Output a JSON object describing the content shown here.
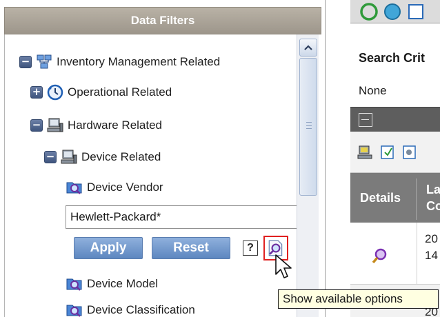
{
  "filters_panel": {
    "title": "Data Filters",
    "tree": {
      "inventory": {
        "label": "Inventory Management Related",
        "toggle": "−"
      },
      "operational": {
        "label": "Operational Related",
        "toggle": "+"
      },
      "hardware": {
        "label": "Hardware Related",
        "toggle": "−"
      },
      "device": {
        "label": "Device Related",
        "toggle": "−"
      },
      "vendor": {
        "label": "Device Vendor"
      },
      "model": {
        "label": "Device Model"
      },
      "classification": {
        "label": "Device Classification"
      }
    },
    "vendor_filter": {
      "value": "Hewlett-Packard*",
      "apply_label": "Apply",
      "reset_label": "Reset",
      "help_label": "?"
    },
    "tooltip": "Show available options"
  },
  "results_panel": {
    "search_criteria_title": "Search Crit",
    "search_criteria_value": "None",
    "columns": {
      "details": "Details",
      "last": "La\nCo"
    },
    "rows": [
      {
        "date": "20\n14"
      },
      {
        "date": "20"
      }
    ]
  },
  "colors": {
    "panel_header": "#a59e93",
    "button": "#6b93c8",
    "toggle": "#4a5f88",
    "grid_header": "#5e5e5e",
    "tooltip_bg": "#ffffe1",
    "highlight": "#e02020"
  },
  "icons": [
    "network-hierarchy-icon",
    "clock-icon",
    "computer-icon",
    "folder-search-icon",
    "magnifier-icon",
    "help-icon",
    "cursor-arrow-icon"
  ]
}
